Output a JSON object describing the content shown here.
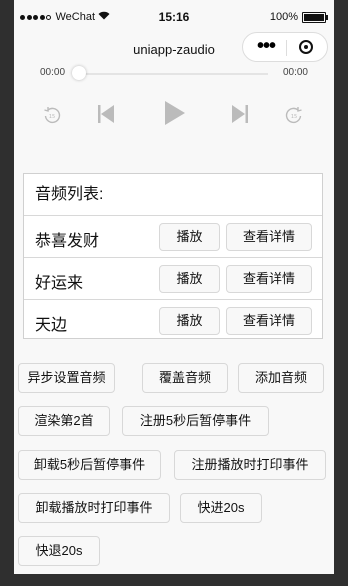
{
  "status_bar": {
    "carrier": "WeChat",
    "time": "15:16",
    "battery": "100%"
  },
  "nav": {
    "title": "uniapp-zaudio"
  },
  "player": {
    "current_time": "00:00",
    "duration": "00:00",
    "progress": 0
  },
  "list": {
    "header": "音频列表:",
    "items": [
      {
        "name": "恭喜发财",
        "play_label": "播放",
        "detail_label": "查看详情"
      },
      {
        "name": "好运来",
        "play_label": "播放",
        "detail_label": "查看详情"
      },
      {
        "name": "天边",
        "play_label": "播放",
        "detail_label": "查看详情"
      }
    ]
  },
  "actions": [
    "异步设置音频",
    "覆盖音频",
    "添加音频",
    "渲染第2首",
    "注册5秒后暂停事件",
    "卸载5秒后暂停事件",
    "注册播放时打印事件",
    "卸载播放时打印事件",
    "快进20s",
    "快退20s"
  ]
}
